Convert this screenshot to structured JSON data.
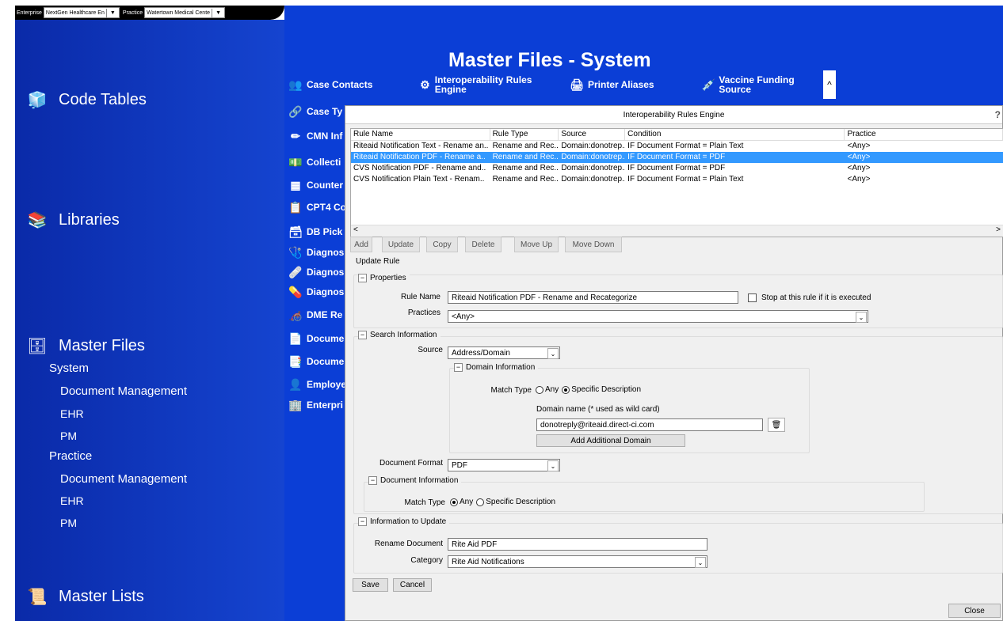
{
  "topbar": {
    "enterprise_label": "Enterprise",
    "enterprise_value": "NextGen Healthcare En",
    "practice_label": "Practice",
    "practice_value": "Watertown Medical Cente"
  },
  "sidebar": {
    "sections": [
      {
        "label": "Code Tables",
        "icon": "cube-icon"
      },
      {
        "label": "Libraries",
        "icon": "books-icon"
      },
      {
        "label": "Master Files",
        "icon": "file-cabinet-icon"
      },
      {
        "label": "Master Lists",
        "icon": "scroll-icon"
      }
    ],
    "master_files": {
      "system_label": "System",
      "system_items": [
        "Document Management",
        "EHR",
        "PM"
      ],
      "practice_label": "Practice",
      "practice_items": [
        "Document Management",
        "EHR",
        "PM"
      ]
    }
  },
  "main": {
    "title": "Master Files - System",
    "top_tiles": [
      "Case Contacts",
      "Interoperability Rules Engine",
      "Printer Aliases",
      "Vaccine Funding Source"
    ],
    "left_tiles": [
      "Case Ty",
      "CMN Inf",
      "Collecti",
      "Counter",
      "CPT4 Co",
      "DB Pick",
      "Diagnos",
      "Diagnos",
      "Diagnos",
      "DME Re",
      "Docume",
      "Docume",
      "Employe",
      "Enterpri"
    ]
  },
  "dialog": {
    "title": "Interoperability Rules Engine",
    "help": "?",
    "columns": [
      "Rule Name",
      "Rule Type",
      "Source",
      "Condition",
      "Practice"
    ],
    "rows": [
      [
        "Riteaid Notification Text - Rename an..",
        "Rename and Rec..",
        "Domain:donotrep..",
        "IF Document Format = Plain Text",
        "<Any>"
      ],
      [
        "Riteaid Notification PDF - Rename a..",
        "Rename and Rec..",
        "Domain:donotrep..",
        "IF Document Format = PDF",
        "<Any>"
      ],
      [
        "CVS Notification PDF - Rename and..",
        "Rename and Rec..",
        "Domain:donotrep..",
        "IF Document Format = PDF",
        "<Any>"
      ],
      [
        "CVS Notification Plain Text - Renam..",
        "Rename and Rec..",
        "Domain:donotrep..",
        "IF Document Format = Plain Text",
        "<Any>"
      ]
    ],
    "selected_row": 1,
    "toolbar": [
      "Add",
      "Update",
      "Copy",
      "Delete",
      "Move Up",
      "Move Down"
    ],
    "update_rule_label": "Update Rule",
    "properties": {
      "header": "Properties",
      "rule_name_label": "Rule Name",
      "rule_name_value": "Riteaid Notification PDF - Rename and Recategorize",
      "stop_label": "Stop at this rule if it is executed",
      "stop_checked": false,
      "practices_label": "Practices",
      "practices_value": "<Any>"
    },
    "search": {
      "header": "Search Information",
      "source_label": "Source",
      "source_value": "Address/Domain",
      "domain_header": "Domain Information",
      "match_type_label": "Match Type",
      "match_any": "Any",
      "match_specific": "Specific Description",
      "domain_match_selected": "specific",
      "domain_name_label": "Domain name (* used as wild card)",
      "domain_name_value": "donotreply@riteaid.direct-ci.com",
      "add_domain_label": "Add Additional Domain",
      "doc_format_label": "Document Format",
      "doc_format_value": "PDF",
      "doc_info_header": "Document Information",
      "doc_match_selected": "any"
    },
    "update": {
      "header": "Information to Update",
      "rename_label": "Rename Document",
      "rename_value": "Rite Aid PDF",
      "category_label": "Category",
      "category_value": "Rite Aid Notifications"
    },
    "save_label": "Save",
    "cancel_label": "Cancel",
    "close_label": "Close"
  }
}
